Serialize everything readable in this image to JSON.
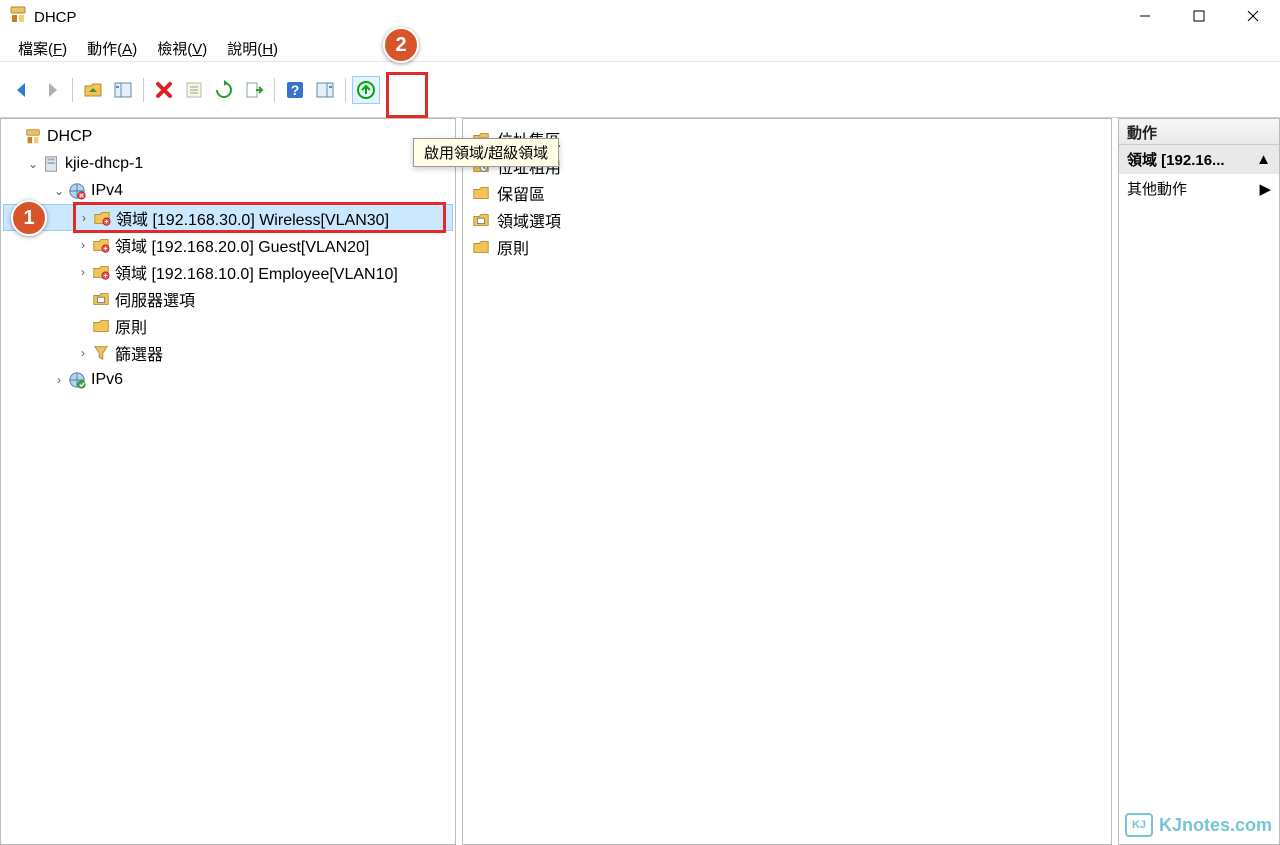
{
  "window": {
    "title": "DHCP"
  },
  "menu": {
    "file": "檔案(F)",
    "action": "動作(A)",
    "view": "檢視(V)",
    "help": "說明(H)"
  },
  "tooltip_enable_scope": "啟用領域/超級領域",
  "tree": {
    "root": "DHCP",
    "server": "kjie-dhcp-1",
    "ipv4": "IPv4",
    "scopes": [
      "領域 [192.168.30.0] Wireless[VLAN30]",
      "領域 [192.168.20.0] Guest[VLAN20]",
      "領域 [192.168.10.0] Employee[VLAN10]"
    ],
    "server_options": "伺服器選項",
    "policies": "原則",
    "filters": "篩選器",
    "ipv6": "IPv6"
  },
  "middle": {
    "items": [
      "位址集區",
      "位址租用",
      "保留區",
      "領域選項",
      "原則"
    ]
  },
  "actions": {
    "header": "動作",
    "scope": "領域 [192.16...",
    "other": "其他動作"
  },
  "callouts": {
    "one": "1",
    "two": "2"
  },
  "watermark": "KJnotes.com"
}
